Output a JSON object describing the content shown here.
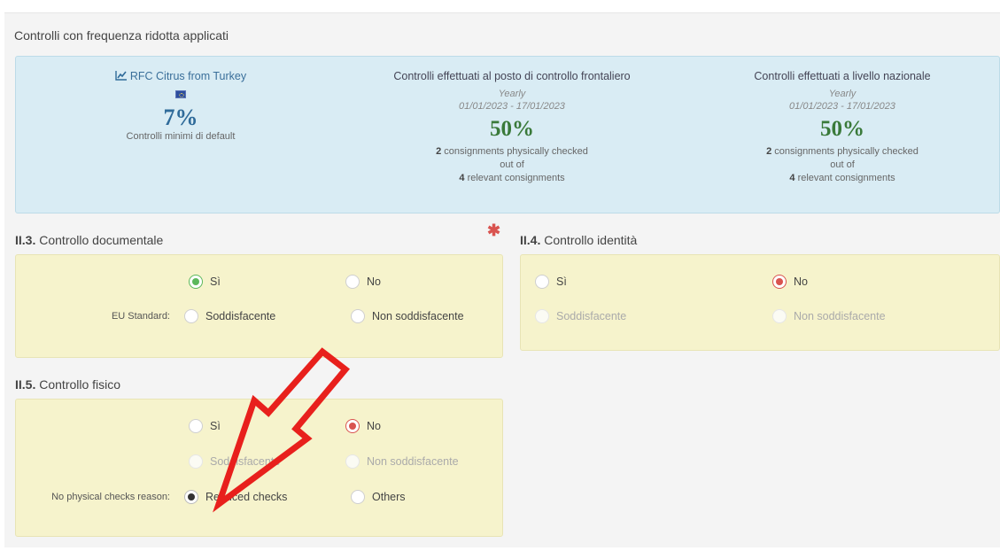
{
  "section_title": "Controlli con frequenza ridotta applicati",
  "info": {
    "rfc": {
      "title": "RFC Citrus from Turkey",
      "icon": "line-chart-icon",
      "flag": "eu-flag-icon",
      "value": "7%",
      "note": "Controlli minimi di default"
    },
    "border": {
      "title": "Controlli effettuati al posto di controllo frontaliero",
      "period": "Yearly",
      "range": "01/01/2023 - 17/01/2023",
      "value": "50%",
      "checked": "2",
      "checked_text": "consignments physically checked",
      "out_of": "out of",
      "relevant": "4",
      "relevant_text": "relevant consignments"
    },
    "national": {
      "title": "Controlli effettuati a livello nazionale",
      "period": "Yearly",
      "range": "01/01/2023 - 17/01/2023",
      "value": "50%",
      "checked": "2",
      "checked_text": "consignments physically checked",
      "out_of": "out of",
      "relevant": "4",
      "relevant_text": "relevant consignments"
    }
  },
  "doc_check": {
    "code": "II.3.",
    "title": "Controllo documentale",
    "required_mark": "✱",
    "yes": "Sì",
    "no": "No",
    "selected": "yes",
    "standard_label": "EU Standard:",
    "satisfactory": "Soddisfacente",
    "unsatisfactory": "Non soddisfacente"
  },
  "identity_check": {
    "code": "II.4.",
    "title": "Controllo identità",
    "yes": "Sì",
    "no": "No",
    "selected": "no",
    "satisfactory": "Soddisfacente",
    "unsatisfactory": "Non soddisfacente"
  },
  "physical_check": {
    "code": "II.5.",
    "title": "Controllo fisico",
    "yes": "Sì",
    "no": "No",
    "selected": "no",
    "satisfactory": "Soddisfacente",
    "unsatisfactory": "Non soddisfacente",
    "reason_label": "No physical checks reason:",
    "reduced": "Reduced checks",
    "others": "Others",
    "reason_selected": "reduced"
  },
  "colors": {
    "info_bg": "#d9ecf4",
    "panel_bg": "#f6f3cc",
    "accent_green": "#5cb85c",
    "accent_red": "#d9534f",
    "annotation_arrow": "#e8201c"
  }
}
